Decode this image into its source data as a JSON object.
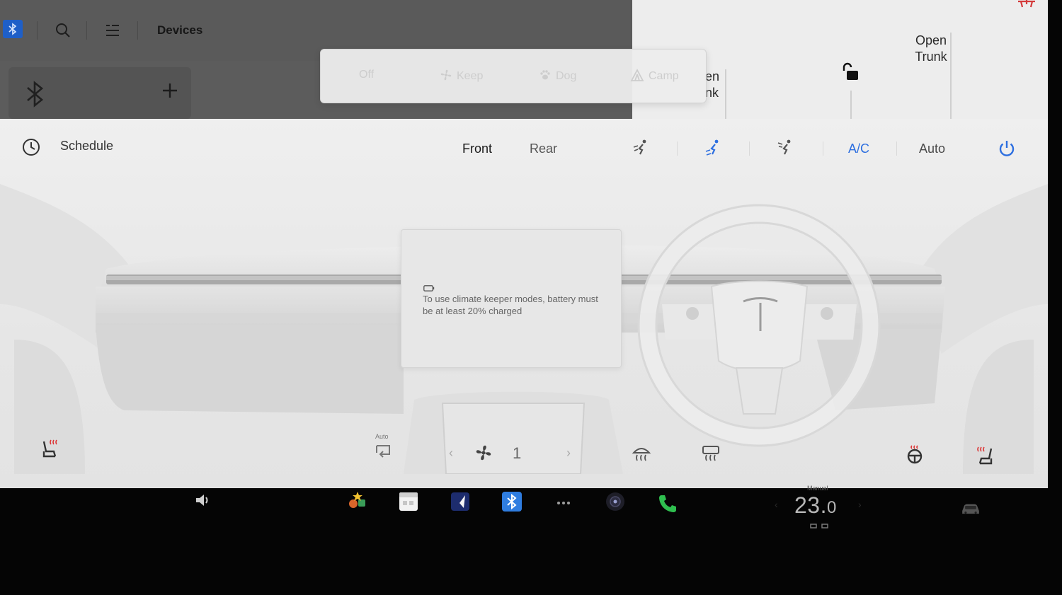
{
  "bluetooth_panel": {
    "title": "Devices",
    "badge_icon": "bluetooth-icon",
    "toolbar_icons": [
      "search-icon",
      "list-icon"
    ],
    "card_icon": "bluetooth-icon",
    "add_icon": "plus-icon"
  },
  "trunk_panel": {
    "frunk_label": "en\nnk",
    "trunk_label": "Open\nTrunk",
    "lock_icon": "unlocked-padlock-icon",
    "alert_icon": "car-alert-icon"
  },
  "keeper_modes": {
    "options": [
      {
        "label": "Off",
        "icon": ""
      },
      {
        "label": "Keep",
        "icon": "fan-icon"
      },
      {
        "label": "Dog",
        "icon": "paw-icon"
      },
      {
        "label": "Camp",
        "icon": "tent-icon"
      }
    ]
  },
  "climate": {
    "schedule_label": "Schedule",
    "tabs": [
      {
        "label": "Front",
        "active": true
      },
      {
        "label": "Rear",
        "active": false
      }
    ],
    "ac_label": "A/C",
    "auto_label": "Auto",
    "accent_color": "#2d6fe0",
    "info_message": "To use climate keeper modes, battery must be at least 20% charged",
    "recirc_mode_label": "Auto",
    "fan_speed": "1"
  },
  "dock": {
    "temp_mode": "Manual",
    "temp_whole": "23.",
    "temp_decimal": "0",
    "icons": [
      "volume-icon",
      "toybox-icon",
      "calendar-icon",
      "navigation-icon",
      "bluetooth-icon",
      "more-icon",
      "camera-icon",
      "phone-icon",
      "car-icon"
    ]
  }
}
